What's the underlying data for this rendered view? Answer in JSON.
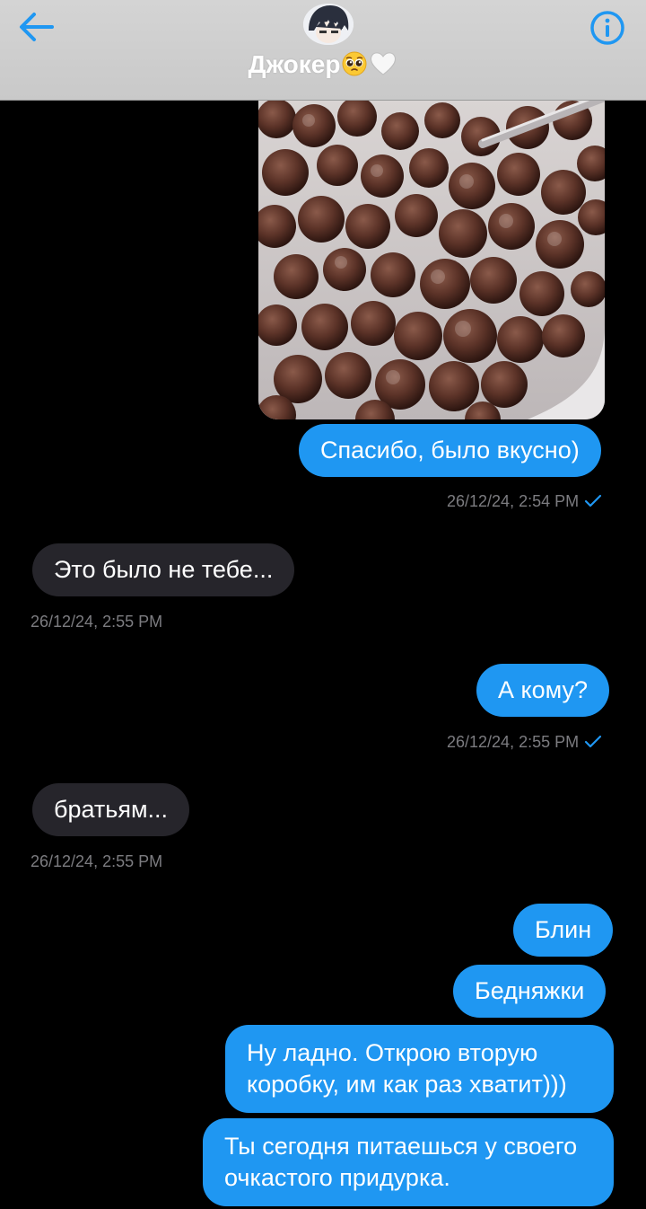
{
  "header": {
    "contact_name": "Джокер",
    "name_emoji_1": "pleading-face",
    "name_emoji_2": "white-heart",
    "accent": "#1f97f2"
  },
  "messages": [
    {
      "direction": "out",
      "type": "photo",
      "alt": "bowl of chocolate cereal balls in milk"
    },
    {
      "direction": "out",
      "text": "Спасибо, было вкусно)",
      "timestamp": "26/12/24, 2:54 PM",
      "status": "sent"
    },
    {
      "direction": "in",
      "text": "Это было не тебе...",
      "timestamp": "26/12/24, 2:55 PM"
    },
    {
      "direction": "out",
      "text": "А кому?",
      "timestamp": "26/12/24, 2:55 PM",
      "status": "sent"
    },
    {
      "direction": "in",
      "text": "братьям...",
      "timestamp": "26/12/24, 2:55 PM"
    },
    {
      "direction": "out",
      "text": "Блин"
    },
    {
      "direction": "out",
      "text": "Бедняжки"
    },
    {
      "direction": "out",
      "text": "Ну ладно. Открою вторую коробку, им как раз хватит)))"
    },
    {
      "direction": "out",
      "text": "Ты сегодня питаешься у своего очкастого придурка."
    }
  ],
  "colors": {
    "outgoing_bubble": "#1f97f2",
    "incoming_bubble": "#26252b",
    "timestamp": "#7c7c80",
    "header_bg": "#d0d0d0"
  }
}
